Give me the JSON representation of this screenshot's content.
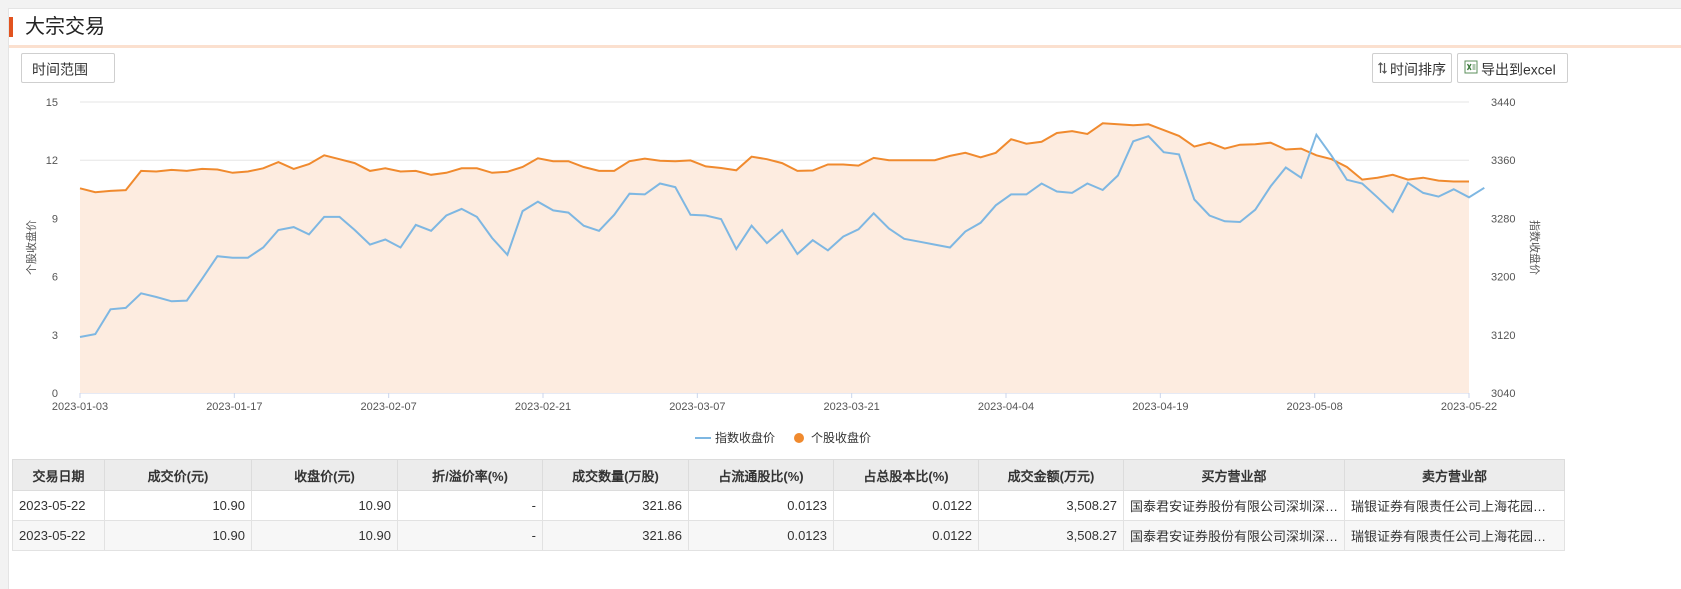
{
  "title": "大宗交易",
  "buttons": {
    "time_range": "时间范围",
    "sort": "时间排序",
    "export": "导出到excel"
  },
  "colors": {
    "accent": "#e2531f",
    "stock_line": "#f08a2e",
    "index_line": "#7eb7e2",
    "area_fill": "#fdece0"
  },
  "chart_data": {
    "type": "line",
    "y_left": {
      "label": "个股收盘价",
      "range": [
        0,
        15
      ],
      "ticks": [
        0,
        3,
        6,
        9,
        12,
        15
      ]
    },
    "y_right": {
      "label": "指数收盘价",
      "range": [
        3040,
        3440
      ],
      "ticks": [
        3040,
        3120,
        3200,
        3280,
        3360,
        3440
      ]
    },
    "x_ticks": [
      "2023-01-03",
      "2023-01-17",
      "2023-02-07",
      "2023-02-21",
      "2023-03-07",
      "2023-03-21",
      "2023-04-04",
      "2023-04-19",
      "2023-05-08",
      "2023-05-22"
    ],
    "grid": true,
    "legend_position": "bottom-center",
    "series": [
      {
        "name": "指数收盘价",
        "axis": "right",
        "values": [
          3117,
          3121,
          3155,
          3157,
          3177,
          3172,
          3166,
          3167,
          3197,
          3228,
          3226,
          3226,
          3240,
          3264,
          3268,
          3258,
          3282,
          3282,
          3264,
          3244,
          3251,
          3240,
          3271,
          3263,
          3284,
          3293,
          3282,
          3253,
          3230,
          3290,
          3303,
          3291,
          3288,
          3270,
          3263,
          3285,
          3314,
          3313,
          3328,
          3323,
          3285,
          3284,
          3279,
          3238,
          3270,
          3246,
          3264,
          3231,
          3250,
          3236,
          3255,
          3265,
          3287,
          3266,
          3252,
          3248,
          3244,
          3240,
          3262,
          3274,
          3298,
          3313,
          3313,
          3328,
          3317,
          3315,
          3328,
          3319,
          3339,
          3386,
          3393,
          3371,
          3368,
          3306,
          3284,
          3276,
          3275,
          3292,
          3324,
          3350,
          3336,
          3395,
          3366,
          3333,
          3328,
          3309,
          3289,
          3329,
          3315,
          3310,
          3320,
          3309,
          3322
        ]
      },
      {
        "name": "个股收盘价",
        "axis": "left",
        "values": [
          10.55,
          10.35,
          10.42,
          10.46,
          11.45,
          11.42,
          11.5,
          11.45,
          11.55,
          11.52,
          11.35,
          11.42,
          11.58,
          11.9,
          11.55,
          11.8,
          12.25,
          12.05,
          11.85,
          11.45,
          11.58,
          11.42,
          11.45,
          11.25,
          11.35,
          11.58,
          11.58,
          11.35,
          11.4,
          11.65,
          12.1,
          11.95,
          11.95,
          11.65,
          11.45,
          11.45,
          11.95,
          12.08,
          11.97,
          11.95,
          11.99,
          11.68,
          11.6,
          11.48,
          12.18,
          12.05,
          11.85,
          11.45,
          11.47,
          11.78,
          11.78,
          11.72,
          12.12,
          12.0,
          12.0,
          12.0,
          12.0,
          12.22,
          12.38,
          12.15,
          12.38,
          13.08,
          12.85,
          12.95,
          13.4,
          13.5,
          13.35,
          13.9,
          13.85,
          13.8,
          13.85,
          13.55,
          13.25,
          12.7,
          12.9,
          12.6,
          12.8,
          12.82,
          12.9,
          12.55,
          12.6,
          12.25,
          12.05,
          11.65,
          11.0,
          11.1,
          11.25,
          11.0,
          11.1,
          10.95,
          10.9,
          10.9
        ]
      }
    ]
  },
  "table": {
    "headers": [
      "交易日期",
      "成交价(元)",
      "收盘价(元)",
      "折/溢价率(%)",
      "成交数量(万股)",
      "占流通股比(%)",
      "占总股本比(%)",
      "成交金额(万元)",
      "买方营业部",
      "卖方营业部"
    ],
    "rows": [
      [
        "2023-05-22",
        "10.90",
        "10.90",
        "-",
        "321.86",
        "0.0123",
        "0.0122",
        "3,508.27",
        "国泰君安证券股份有限公司深圳深…",
        "瑞银证券有限责任公司上海花园…"
      ],
      [
        "2023-05-22",
        "10.90",
        "10.90",
        "-",
        "321.86",
        "0.0123",
        "0.0122",
        "3,508.27",
        "国泰君安证券股份有限公司深圳深…",
        "瑞银证券有限责任公司上海花园…"
      ]
    ]
  }
}
